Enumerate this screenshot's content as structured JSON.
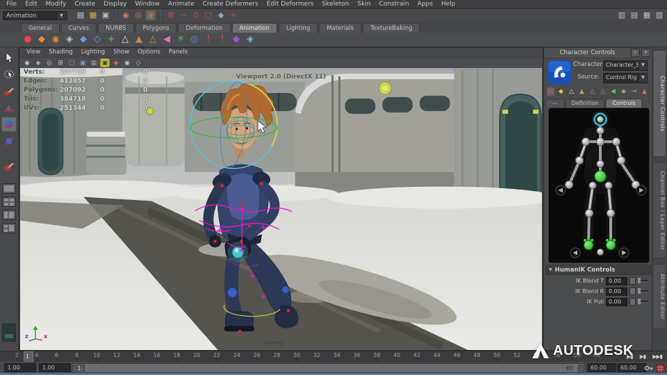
{
  "watermark": {
    "brand": "AUTODESK"
  },
  "menubar": {
    "items": [
      "File",
      "Edit",
      "Modify",
      "Create",
      "Display",
      "Window",
      "Animate",
      "Create Deformers",
      "Edit Deformers",
      "Skeleton",
      "Skin",
      "Constrain",
      "Apps",
      "Help"
    ]
  },
  "statusline": {
    "menu_set_value": "Animation",
    "file_group": [
      {
        "name": "new-scene-icon",
        "glyph": "▤",
        "color": "#d6d6d6"
      },
      {
        "name": "open-scene-icon",
        "glyph": "▦",
        "color": "#d9b23c"
      },
      {
        "name": "save-scene-icon",
        "glyph": "▣",
        "color": "#b9bcc4"
      }
    ],
    "selection_group": [
      {
        "name": "select-hierarchy-icon",
        "glyph": "◉",
        "color": "#cf7a52"
      },
      {
        "name": "select-object-icon",
        "glyph": "◎",
        "color": "#cf7a52"
      },
      {
        "name": "select-component-icon",
        "glyph": "◈",
        "color": "#cf7a52",
        "active": true
      }
    ],
    "snap_group": [
      {
        "name": "snap-grid-icon",
        "glyph": "⊞",
        "color": "#cc4b4b"
      },
      {
        "name": "snap-curve-icon",
        "glyph": "~",
        "color": "#cc4b4b"
      },
      {
        "name": "snap-point-icon",
        "glyph": "⊙",
        "color": "#cc4b4b"
      },
      {
        "name": "snap-plane-icon",
        "glyph": "□",
        "color": "#cc4b4b"
      },
      {
        "name": "make-live-icon",
        "glyph": "◆",
        "color": "#9aa0a8"
      },
      {
        "name": "snap-center-icon",
        "glyph": "+",
        "color": "#cc4b4b"
      }
    ],
    "panel_toggles": [
      {
        "name": "attribute-editor-toggle-icon",
        "glyph": "▥",
        "color": "#c0c0c0"
      },
      {
        "name": "tool-settings-toggle-icon",
        "glyph": "▤",
        "color": "#c0c0c0"
      },
      {
        "name": "channel-box-toggle-icon",
        "glyph": "▦",
        "color": "#c0c0c0"
      },
      {
        "name": "panel-layout-toggle-icon",
        "glyph": "▧",
        "color": "#c0c0c0"
      }
    ]
  },
  "shelf": {
    "tabs": [
      "General",
      "Curves",
      "NURBS",
      "Polygons",
      "Deformation",
      "Animation",
      "Lighting",
      "Materials",
      "TextureBaking"
    ],
    "active_tab": "Animation",
    "icons": [
      {
        "name": "set-key-icon",
        "glyph": "●",
        "color": "#e04848"
      },
      {
        "name": "move-nearest-icon",
        "glyph": "◆",
        "color": "#e08a3a"
      },
      {
        "name": "rotate-nearest-icon",
        "glyph": "◉",
        "color": "#e08a3a"
      },
      {
        "name": "snap-to-skeleton-icon",
        "glyph": "◈",
        "color": "#b8c0cc"
      },
      {
        "name": "joint-tool-icon",
        "glyph": "◆",
        "color": "#6a9ae0"
      },
      {
        "name": "ik-handle-tool-icon",
        "glyph": "◇",
        "color": "#6a9ae0"
      },
      {
        "name": "ik-spline-tool-icon",
        "glyph": "+",
        "color": "#58c858"
      },
      {
        "name": "skeleton-icon",
        "glyph": "△",
        "color": "#e0e0e0"
      },
      {
        "name": "bind-skin-icon",
        "glyph": "▲",
        "color": "#c8884a"
      },
      {
        "name": "detach-skin-icon",
        "glyph": "△",
        "color": "#c8884a"
      },
      {
        "name": "paint-skin-weights-icon",
        "glyph": "◀",
        "color": "#e078b8"
      },
      {
        "name": "motion-trail-icon",
        "glyph": "＊",
        "color": "#48c848"
      },
      {
        "name": "turntable-icon",
        "glyph": "◎",
        "color": "#5890e0"
      },
      {
        "name": "bake-simulation-icon",
        "glyph": "!",
        "color": "#e04848"
      },
      {
        "name": "delete-keys-icon",
        "glyph": "!",
        "color": "#e04848"
      },
      {
        "name": "up-axis-icon",
        "glyph": "◆",
        "color": "#9a58d8"
      },
      {
        "name": "pairblend-icon",
        "glyph": "◈",
        "color": "#68b8e0"
      }
    ]
  },
  "toolbox": {
    "tools": [
      {
        "name": "select-tool"
      },
      {
        "name": "lasso-select-tool"
      },
      {
        "name": "paint-select-tool"
      },
      {
        "name": "move-tool"
      },
      {
        "name": "rotate-tool",
        "active": true
      },
      {
        "name": "scale-tool"
      }
    ]
  },
  "viewport": {
    "menu": [
      "View",
      "Shading",
      "Lighting",
      "Show",
      "Options",
      "Panels"
    ],
    "toolbar": [
      {
        "name": "select-camera-icon",
        "glyph": "◉",
        "color": "#c4c4c4"
      },
      {
        "name": "lock-camera-icon",
        "glyph": "◈",
        "color": "#c4c4c4"
      },
      {
        "name": "camera-attributes-icon",
        "glyph": "◎",
        "color": "#c4c4c4"
      },
      {
        "name": "grid-icon",
        "glyph": "⊞",
        "color": "#c4c4c4"
      },
      {
        "name": "film-gate-icon",
        "glyph": "□",
        "color": "#7a9ac8"
      },
      {
        "name": "resolution-gate-icon",
        "glyph": "▣",
        "color": "#7a9ac8"
      },
      {
        "name": "gate-mask-icon",
        "glyph": "▦",
        "color": "#9a9a9a"
      },
      {
        "name": "lighting-icon",
        "glyph": "▣",
        "color": "#3a3a1a",
        "active": true,
        "bg": "#c8c83e"
      },
      {
        "name": "shadows-icon",
        "glyph": "◆",
        "color": "#c86a4a"
      },
      {
        "name": "textured-icon",
        "glyph": "◉",
        "color": "#c4c4c4"
      },
      {
        "name": "xray-icon",
        "glyph": "◇",
        "color": "#c4c4c4"
      }
    ],
    "hud": {
      "rows": [
        {
          "label": "Verts:",
          "total": "207739",
          "selected": "0",
          "extra": "0"
        },
        {
          "label": "Edges:",
          "total": "412857",
          "selected": "0",
          "extra": "0"
        },
        {
          "label": "Polygons:",
          "total": "207092",
          "selected": "0",
          "extra": "0"
        },
        {
          "label": "Tris:",
          "total": "384718",
          "selected": "0",
          "extra": "0"
        },
        {
          "label": "UVs:",
          "total": "251344",
          "selected": "0",
          "extra": "0"
        }
      ]
    },
    "renderer_label": "Viewport 2.0 (DirectX 11)",
    "camera_label": "persp",
    "axis": {
      "x": "x",
      "z": "z"
    }
  },
  "character_controls": {
    "title": "Character Controls",
    "window_buttons": [
      {
        "name": "panel-dock-icon",
        "glyph": "▫"
      },
      {
        "name": "panel-close-icon",
        "glyph": "×"
      }
    ],
    "character_label": "Character:",
    "character_value": "Character_Sven",
    "source_label": "Source:",
    "source_value": "Control Rig",
    "toolbar": [
      {
        "name": "body-part-mode-icon",
        "glyph": "⊞",
        "color": "#cc4b4b",
        "active": true
      },
      {
        "name": "pin-translate-icon",
        "glyph": "◆",
        "color": "#d8c84a"
      },
      {
        "name": "skeleton-figure-icon",
        "glyph": "△",
        "color": "#e0e0e0"
      },
      {
        "name": "character-figure-icon",
        "glyph": "▲",
        "color": "#d8943a"
      },
      {
        "name": "control-rig-figure-icon",
        "glyph": "△",
        "color": "#d8943a"
      },
      {
        "name": "dim-figure-icon",
        "glyph": "△",
        "color": "#8a8a8a"
      },
      {
        "name": "keying-group-icon",
        "glyph": "◀",
        "color": "#58c858"
      },
      {
        "name": "mirror-pose-icon",
        "glyph": "◈",
        "color": "#b8c848"
      },
      {
        "name": "go-arrow-icon",
        "glyph": "→",
        "color": "#9aa0a8"
      },
      {
        "name": "stance-pose-icon",
        "glyph": "▲",
        "color": "#d8794a"
      }
    ],
    "tabs": [
      {
        "label": "---"
      },
      {
        "label": "Definition"
      },
      {
        "label": "Controls",
        "active": true
      }
    ],
    "humanik": {
      "title": "HumanIK Controls",
      "sliders": [
        {
          "label": "IK Blend T",
          "value": "0.00"
        },
        {
          "label": "IK Blend R",
          "value": "0.00"
        },
        {
          "label": "IK Pull",
          "value": "0.00"
        }
      ]
    }
  },
  "right_tabs": [
    {
      "label": "Character Controls",
      "active": true
    },
    {
      "label": "Channel Box / Layer Editor"
    },
    {
      "label": "Attribute Editor"
    }
  ],
  "timeline": {
    "tick_labels": [
      "2",
      "4",
      "6",
      "8",
      "10",
      "12",
      "14",
      "16",
      "18",
      "20",
      "22",
      "24",
      "26",
      "28",
      "30",
      "32",
      "34",
      "36",
      "38",
      "40",
      "42",
      "44",
      "46",
      "48",
      "50",
      "52",
      "54",
      "56",
      "58",
      "60"
    ],
    "current_frame": "1",
    "transport": [
      {
        "name": "step-forward-key-button",
        "glyph": "▶▮"
      },
      {
        "name": "step-forward-frame-button",
        "glyph": "▶▮"
      },
      {
        "name": "go-to-end-button",
        "glyph": "▶▶▮"
      }
    ]
  },
  "range_slider": {
    "anim_start": "1.00",
    "playback_start": "1.00",
    "handle_start": "1",
    "handle_end": "60",
    "playback_end": "60.00",
    "anim_end": "60.00"
  }
}
